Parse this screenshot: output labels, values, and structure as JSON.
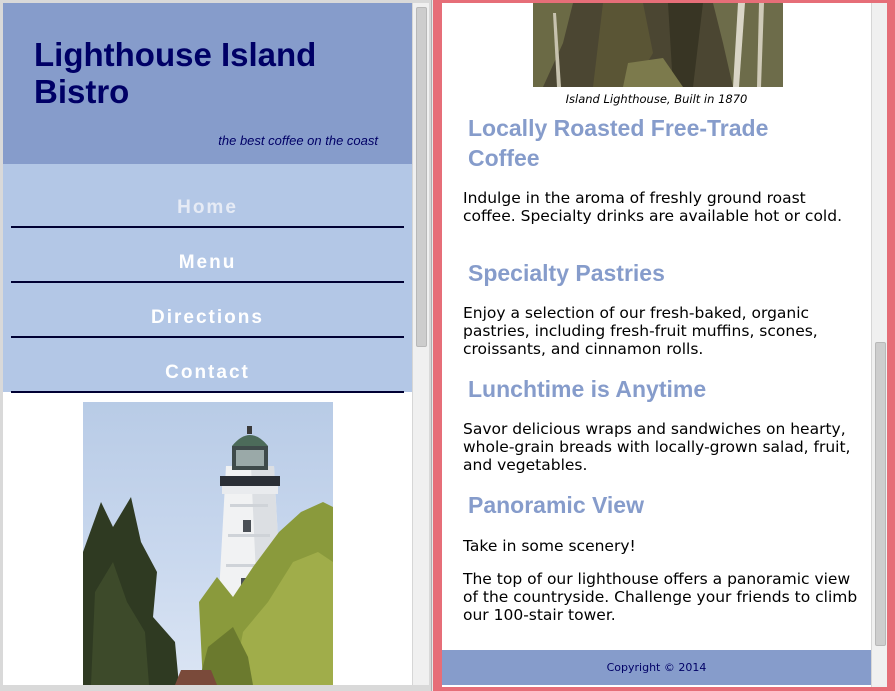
{
  "site": {
    "title": "Lighthouse Island Bistro",
    "tagline": "the best coffee on the coast"
  },
  "nav": {
    "items": [
      {
        "label": "Home",
        "current": true
      },
      {
        "label": "Menu",
        "current": false
      },
      {
        "label": "Directions",
        "current": false
      },
      {
        "label": "Contact",
        "current": false
      }
    ]
  },
  "photo": {
    "caption": "Island Lighthouse, Built in 1870"
  },
  "sections": [
    {
      "heading": "Locally Roasted Free-Trade Coffee",
      "paragraphs": [
        "Indulge in the aroma of freshly ground roast coffee. Specialty drinks are available hot or cold."
      ]
    },
    {
      "heading": "Specialty Pastries",
      "paragraphs": [
        "Enjoy a selection of our fresh-baked, organic pastries, including fresh-fruit muffins, scones, croissants, and cinnamon rolls."
      ]
    },
    {
      "heading": "Lunchtime is Anytime",
      "paragraphs": [
        "Savor delicious wraps and sandwiches on hearty, whole-grain breads with locally-grown salad, fruit, and vegetables."
      ]
    },
    {
      "heading": "Panoramic View",
      "paragraphs": [
        "Take in some scenery!",
        "The top of our lighthouse offers a panoramic view of the countryside. Challenge your friends to climb our 100-stair tower."
      ]
    }
  ],
  "footer": {
    "copyright": "Copyright © 2014"
  },
  "colors": {
    "header_bg": "#869ccb",
    "nav_bg": "#b3c7e6",
    "title_text": "#000066",
    "heading_text": "#869ccb",
    "active_frame": "#e66e78"
  }
}
